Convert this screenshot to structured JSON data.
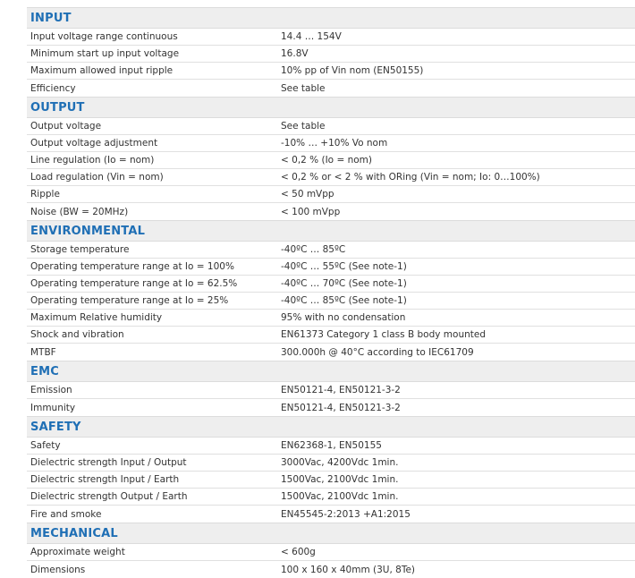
{
  "sections": [
    {
      "title": "INPUT",
      "rows": [
        [
          "Input voltage range continuous",
          "14.4 … 154V"
        ],
        [
          "Minimum start up input voltage",
          "16.8V"
        ],
        [
          "Maximum allowed input ripple",
          "10% pp of Vin nom (EN50155)"
        ],
        [
          "Efficiency",
          "See table"
        ]
      ]
    },
    {
      "title": "OUTPUT",
      "rows": [
        [
          "Output voltage",
          "See table"
        ],
        [
          "Output voltage adjustment",
          "-10% … +10% Vo nom"
        ],
        [
          "Line regulation (Io = nom)",
          "< 0,2 % (Io = nom)"
        ],
        [
          "Load regulation (Vin = nom)",
          "< 0,2 % or < 2 % with ORing (Vin = nom; Io: 0…100%)"
        ],
        [
          "Ripple",
          "< 50 mVpp"
        ],
        [
          "Noise (BW = 20MHz)",
          "< 100 mVpp"
        ]
      ]
    },
    {
      "title": "ENVIRONMENTAL",
      "rows": [
        [
          "Storage temperature",
          "-40ºC … 85ºC"
        ],
        [
          "Operating temperature range at Io = 100%",
          "-40ºC … 55ºC (See note-1)"
        ],
        [
          "Operating temperature range at Io = 62.5%",
          "-40ºC … 70ºC (See note-1)"
        ],
        [
          "Operating temperature range at Io = 25%",
          "-40ºC … 85ºC (See note-1)"
        ],
        [
          "Maximum Relative humidity",
          "95% with no condensation"
        ],
        [
          "Shock and vibration",
          "EN61373 Category 1 class B body mounted"
        ],
        [
          "MTBF",
          "300.000h @ 40°C according to IEC61709"
        ]
      ]
    },
    {
      "title": "EMC",
      "rows": [
        [
          "Emission",
          "EN50121-4, EN50121-3-2"
        ],
        [
          "Immunity",
          "EN50121-4, EN50121-3-2"
        ]
      ]
    },
    {
      "title": "SAFETY",
      "rows": [
        [
          "Safety",
          "EN62368-1, EN50155"
        ],
        [
          "Dielectric strength Input / Output",
          "3000Vac, 4200Vdc  1min."
        ],
        [
          "Dielectric strength Input / Earth",
          "1500Vac, 2100Vdc  1min."
        ],
        [
          "Dielectric strength Output / Earth",
          "1500Vac, 2100Vdc  1min."
        ],
        [
          "Fire and smoke",
          "EN45545-2:2013 +A1:2015"
        ]
      ]
    },
    {
      "title": "MECHANICAL",
      "rows": [
        [
          "Approximate weight",
          "< 600g"
        ],
        [
          "Dimensions",
          "100 x 160 x 40mm (3U, 8Te)"
        ]
      ]
    }
  ]
}
